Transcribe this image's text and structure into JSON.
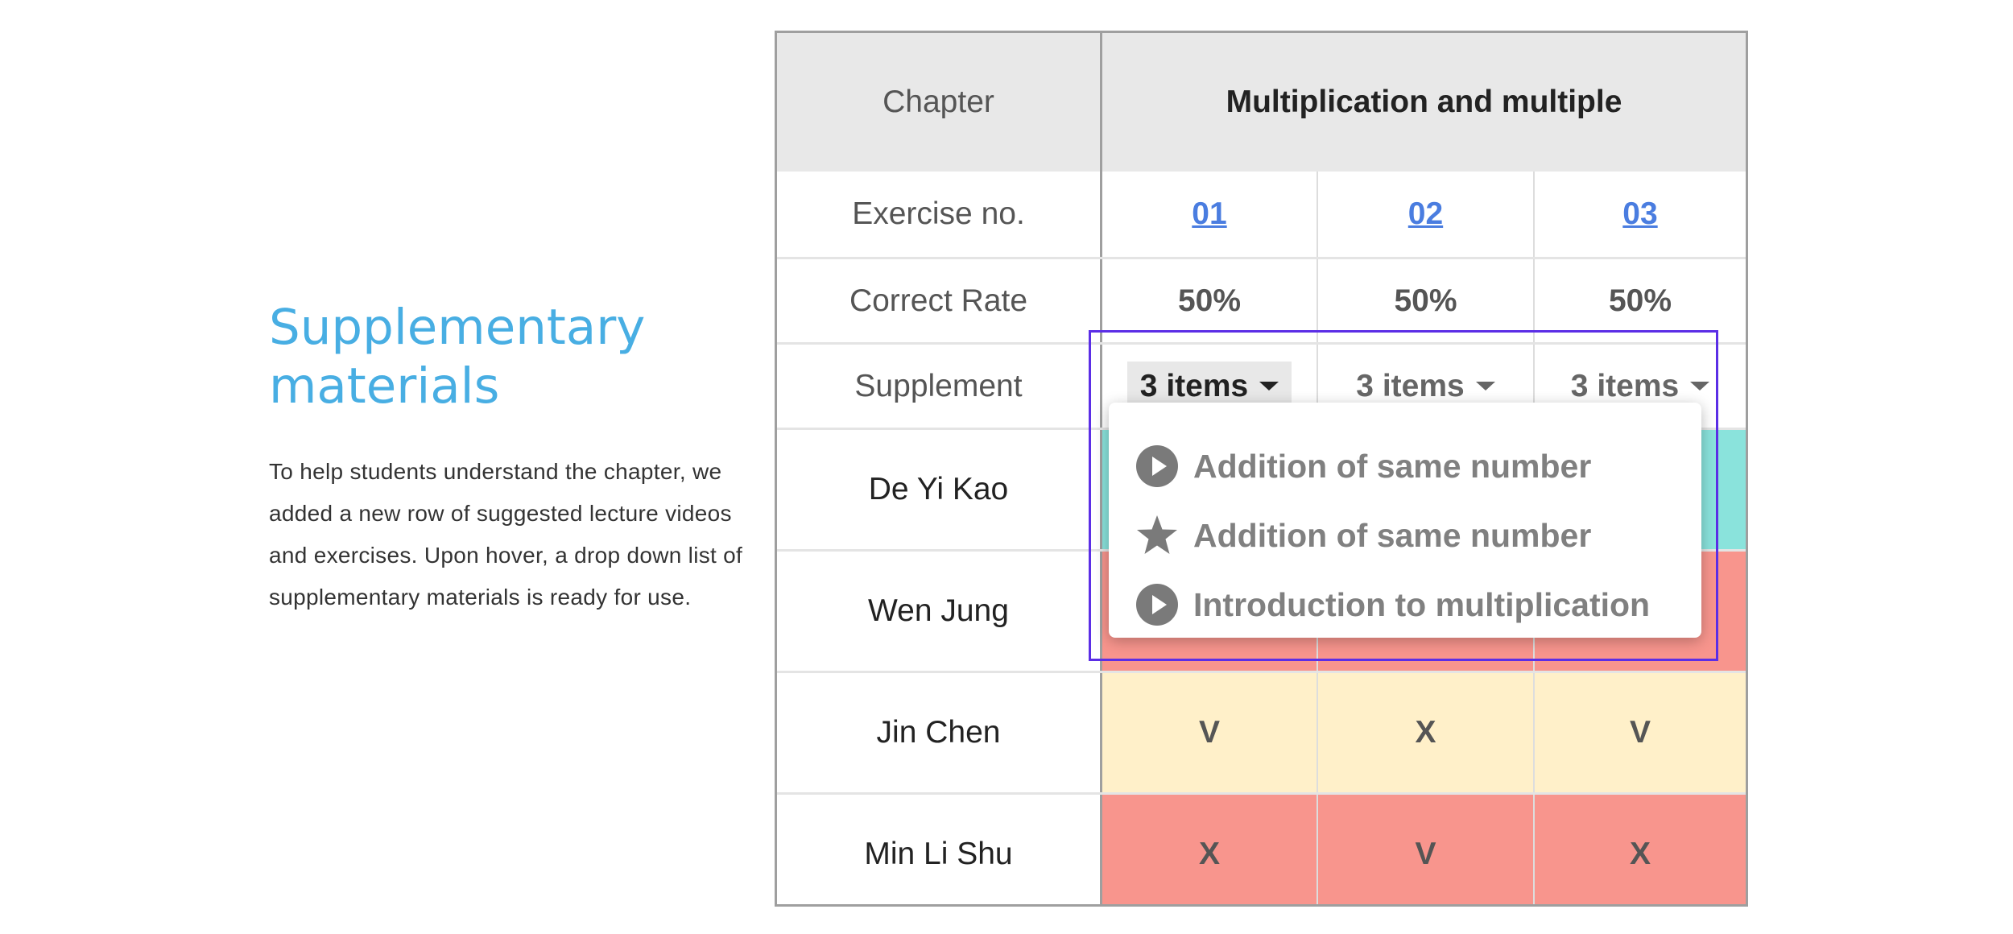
{
  "intro": {
    "title_line1": "Supplementary",
    "title_line2": "materials",
    "description": "To help students understand the chapter, we added a new row of suggested lecture videos and exercises. Upon hover, a drop down list of supplementary materials is ready for use.",
    "title_color": "#48aee3"
  },
  "table": {
    "chapter_label": "Chapter",
    "chapter_name": "Multiplication and multiple",
    "exercise_label": "Exercise no.",
    "exercises": [
      "01",
      "02",
      "03"
    ],
    "correct_rate_label": "Correct Rate",
    "correct_rates": [
      "50%",
      "50%",
      "50%"
    ],
    "supplement_label": "Supplement",
    "supplements": [
      "3 items",
      "3 items",
      "3 items"
    ],
    "students": [
      {
        "name": "De Yi Kao",
        "results": [
          "",
          "",
          ""
        ],
        "color": "#8ae3dc"
      },
      {
        "name": "Wen Jung",
        "results": [
          "",
          "",
          ""
        ],
        "color": "#f8958d"
      },
      {
        "name": "Jin Chen",
        "results": [
          "V",
          "X",
          "V"
        ],
        "color": "#fff0c9"
      },
      {
        "name": "Min Li Shu",
        "results": [
          "X",
          "V",
          "X"
        ],
        "color": "#f8958d"
      }
    ]
  },
  "dropdown_menu": {
    "items": [
      {
        "icon": "play-circle-icon",
        "label": "Addition of same number"
      },
      {
        "icon": "star-icon",
        "label": "Addition of same number"
      },
      {
        "icon": "play-circle-icon",
        "label": "Introduction to multiplication"
      }
    ]
  },
  "colors": {
    "link": "#4a7de0",
    "hover_outline": "#5b2ee6",
    "header_bg": "#e8e8e8"
  }
}
